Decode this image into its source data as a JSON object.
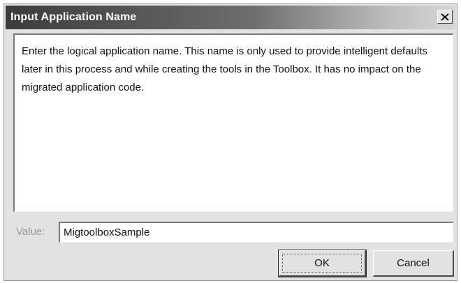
{
  "dialog": {
    "title": "Input Application Name",
    "close_glyph": "×",
    "message": "Enter the logical application name.  This name is only used to provide intelligent defaults later in this process and while creating the tools in the Toolbox.  It has no impact on the migrated application code.",
    "value_label": "Value:",
    "value": "MigtoolboxSample",
    "ok_label": "OK",
    "cancel_label": "Cancel"
  },
  "icons": {
    "close": "close-icon"
  },
  "colors": {
    "titlebar_start": "#3c3c3c",
    "titlebar_end": "#d6d6d6",
    "dialog_background": "#e2e2e2"
  }
}
